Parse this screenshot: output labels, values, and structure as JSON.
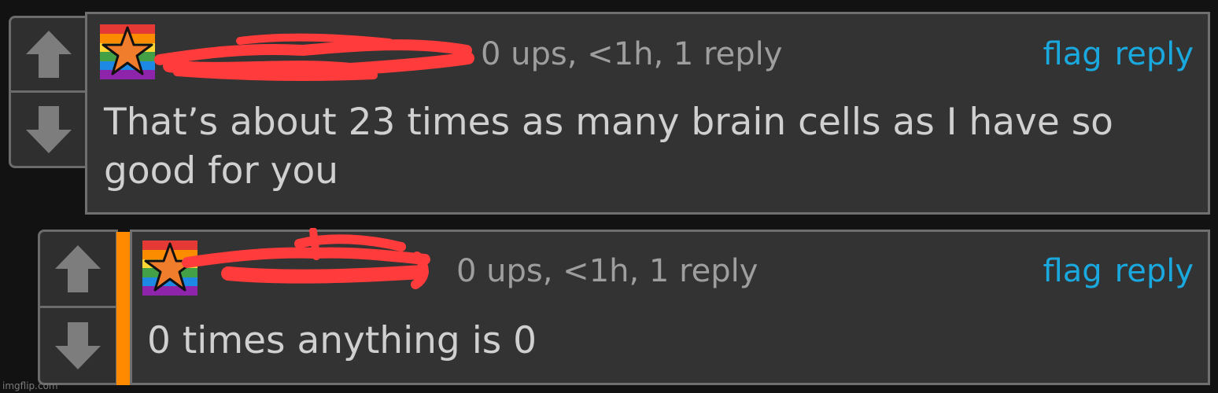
{
  "comments": [
    {
      "meta": "0 ups, <1h, 1 reply",
      "body": "That’s about 23 times as many brain cells as I have so good for you",
      "actions": {
        "flag": "flag",
        "reply": "reply"
      },
      "upvote_icon": "arrow-up-icon",
      "downvote_icon": "arrow-down-icon",
      "username_redacted": true
    },
    {
      "meta": "0 ups, <1h, 1 reply",
      "body": "0 times anything is 0",
      "actions": {
        "flag": "flag",
        "reply": "reply"
      },
      "upvote_icon": "arrow-up-icon",
      "downvote_icon": "arrow-down-icon",
      "username_redacted": true
    }
  ],
  "watermark": "imgflip.com",
  "colors": {
    "background": "#121212",
    "panel": "#333333",
    "link": "#1aa9df",
    "meta_text": "#9e9e9e",
    "body_text": "#d0d0d0",
    "reply_depth_bar": "#ff8a00",
    "redaction": "#ff3b3b"
  }
}
